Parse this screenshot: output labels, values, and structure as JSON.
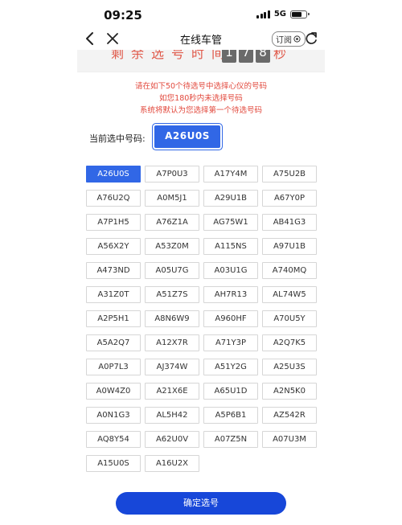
{
  "status_bar": {
    "time": "09:25",
    "network": "5G"
  },
  "nav": {
    "title": "在线车管",
    "subscribe_label": "订阅"
  },
  "countdown": {
    "label": "剩余选号时间",
    "digits": [
      "1",
      "7",
      "8"
    ],
    "unit": "秒"
  },
  "notice": {
    "line1": "请在如下50个待选号中选择心仪的号码",
    "line2": "如您180秒内未选择号码",
    "line3": "系统将默认为您选择第一个待选号码"
  },
  "current": {
    "label": "当前选中号码:",
    "plate": "A26U0S"
  },
  "plates": [
    "A26U0S",
    "A7P0U3",
    "A17Y4M",
    "A75U2B",
    "A76U2Q",
    "A0M5J1",
    "A29U1B",
    "A67Y0P",
    "A7P1H5",
    "A76Z1A",
    "AG75W1",
    "AB41G3",
    "A56X2Y",
    "A53Z0M",
    "A115NS",
    "A97U1B",
    "A473ND",
    "A05U7G",
    "A03U1G",
    "A740MQ",
    "A31Z0T",
    "A51Z7S",
    "AH7R13",
    "AL74W5",
    "A2P5H1",
    "A8N6W9",
    "A960HF",
    "A70U5Y",
    "A5A2Q7",
    "A12X7R",
    "A71Y3P",
    "A2Q7K5",
    "A0P7L3",
    "AJ374W",
    "A51Y2G",
    "A25U3S",
    "A0W4Z0",
    "A21X6E",
    "A65U1D",
    "A2N5K0",
    "A0N1G3",
    "AL5H42",
    "A5P6B1",
    "AZ542R",
    "AQ8Y54",
    "A62U0V",
    "A07Z5N",
    "A07U3M",
    "A15U0S",
    "A16U2X"
  ],
  "selected_index": 0,
  "confirm_label": "确定选号",
  "colors": {
    "accent": "#3167e6",
    "confirm": "#1747d9",
    "notice": "#e2483c"
  }
}
